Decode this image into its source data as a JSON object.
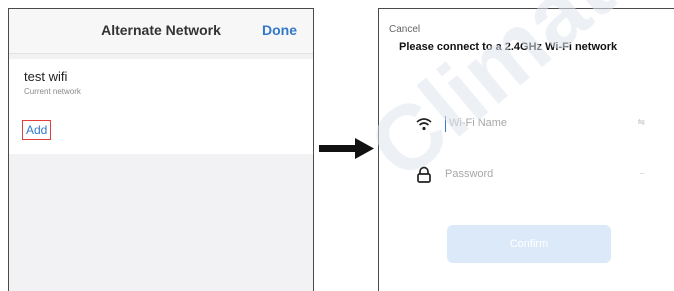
{
  "left_screen": {
    "title": "Alternate Network",
    "done_label": "Done",
    "network": {
      "name": "test wifi",
      "status": "Current network"
    },
    "add_label": "Add"
  },
  "right_screen": {
    "cancel_label": "Cancel",
    "heading": "Please connect to a 2.4GHz Wi-Fi network",
    "ssid_placeholder": "Wi-Fi Name",
    "ssid_trailing": "⇋",
    "password_placeholder": "Password",
    "password_trailing": "⌣",
    "confirm_label": "Confirm"
  },
  "watermark_text": "Climat",
  "icons": {
    "wifi": "wifi-icon",
    "lock": "lock-icon",
    "arrow": "arrow-right-icon"
  },
  "colors": {
    "accent_blue": "#3478c8",
    "highlight_red": "#e0403a",
    "confirm_disabled": "#dbe9f8"
  }
}
